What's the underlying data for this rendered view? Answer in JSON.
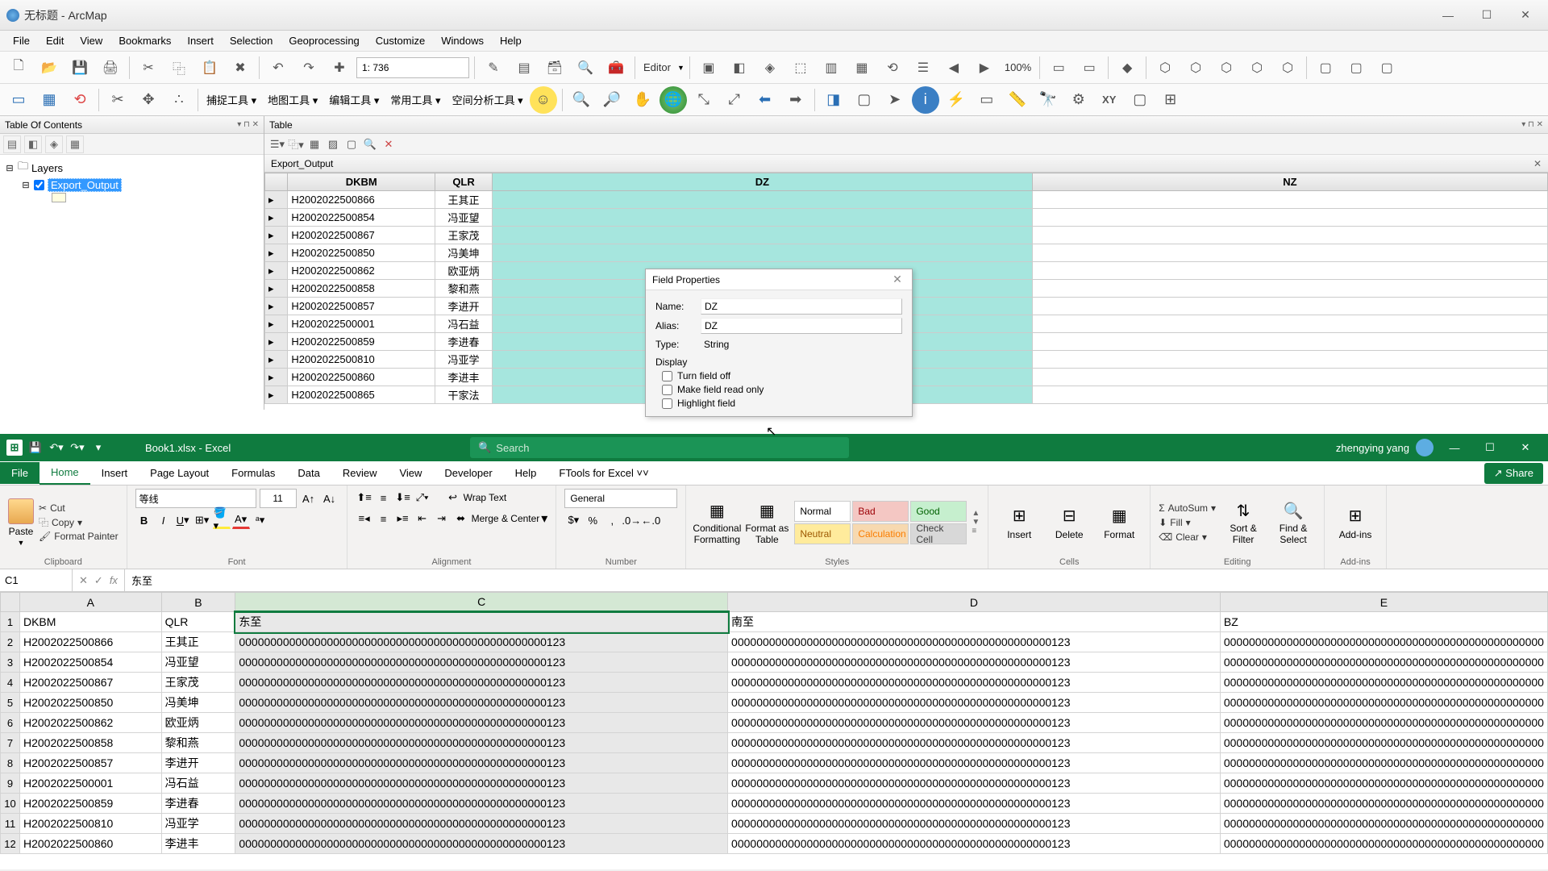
{
  "arcmap": {
    "title": "无标题 - ArcMap",
    "menu": [
      "File",
      "Edit",
      "View",
      "Bookmarks",
      "Insert",
      "Selection",
      "Geoprocessing",
      "Customize",
      "Windows",
      "Help"
    ],
    "scale": "1: 736",
    "editor_label": "Editor",
    "zoom_pct": "100%",
    "toolbox_labels": [
      "捕捉工具",
      "地图工具",
      "编辑工具",
      "常用工具",
      "空间分析工具"
    ],
    "toc": {
      "title": "Table Of Contents",
      "layers_label": "Layers",
      "layer_selected": "Export_Output"
    },
    "table_panel": {
      "title": "Table",
      "tab": "Export_Output",
      "cols": [
        "DKBM",
        "QLR",
        "DZ",
        "NZ"
      ],
      "rows": [
        {
          "dkbm": "H2002022500866",
          "qlr": "王其正"
        },
        {
          "dkbm": "H2002022500854",
          "qlr": "冯亚望"
        },
        {
          "dkbm": "H2002022500867",
          "qlr": "王家茂"
        },
        {
          "dkbm": "H2002022500850",
          "qlr": "冯美坤"
        },
        {
          "dkbm": "H2002022500862",
          "qlr": "欧亚炳"
        },
        {
          "dkbm": "H2002022500858",
          "qlr": "黎和燕"
        },
        {
          "dkbm": "H2002022500857",
          "qlr": "李进开"
        },
        {
          "dkbm": "H2002022500001",
          "qlr": "冯石益"
        },
        {
          "dkbm": "H2002022500859",
          "qlr": "李进春"
        },
        {
          "dkbm": "H2002022500810",
          "qlr": "冯亚学"
        },
        {
          "dkbm": "H2002022500860",
          "qlr": "李进丰"
        },
        {
          "dkbm": "H2002022500865",
          "qlr": "干家法"
        }
      ]
    },
    "field_dlg": {
      "title": "Field Properties",
      "name_lbl": "Name:",
      "name_val": "DZ",
      "alias_lbl": "Alias:",
      "alias_val": "DZ",
      "type_lbl": "Type:",
      "type_val": "String",
      "display_lbl": "Display",
      "chk1": "Turn field off",
      "chk2": "Make field read only",
      "chk3": "Highlight field"
    }
  },
  "excel": {
    "doc": "Book1.xlsx  -  Excel",
    "search_ph": "Search",
    "user": "zhengying yang",
    "tabs": [
      "File",
      "Home",
      "Insert",
      "Page Layout",
      "Formulas",
      "Data",
      "Review",
      "View",
      "Developer",
      "Help",
      "FTools for Excel ˅˅"
    ],
    "share": "Share",
    "clipboard": {
      "paste": "Paste",
      "cut": "Cut",
      "copy": "Copy",
      "fp": "Format Painter",
      "grp": "Clipboard"
    },
    "font": {
      "name": "等线",
      "size": "11",
      "grp": "Font"
    },
    "align": {
      "wrap": "Wrap Text",
      "merge": "Merge & Center",
      "grp": "Alignment"
    },
    "number": {
      "fmt": "General",
      "grp": "Number"
    },
    "styles": {
      "cf": "Conditional Formatting",
      "fat": "Format as Table",
      "normal": "Normal",
      "bad": "Bad",
      "good": "Good",
      "neutral": "Neutral",
      "calc": "Calculation",
      "check": "Check Cell",
      "grp": "Styles"
    },
    "cells": {
      "ins": "Insert",
      "del": "Delete",
      "fmt": "Format",
      "grp": "Cells"
    },
    "editing": {
      "sum": "AutoSum",
      "fill": "Fill",
      "clear": "Clear",
      "sort": "Sort & Filter",
      "find": "Find & Select",
      "grp": "Editing"
    },
    "addins": {
      "lbl": "Add-ins",
      "grp": "Add-ins"
    },
    "namebox": "C1",
    "formula": "东至",
    "cols": [
      "",
      "A",
      "B",
      "C",
      "D",
      "E"
    ],
    "hdr_row": {
      "A": "DKBM",
      "B": "QLR",
      "C": "东至",
      "D": "南至",
      "E": "BZ"
    },
    "long_c": "0000000000000000000000000000000000000000000000000123",
    "long_d": "000000000000000000000000000000000000000000000000000123",
    "long_e": "000000000000000000000000000000000000000000000000000",
    "rows": [
      {
        "n": "2",
        "A": "H2002022500866",
        "B": "王其正"
      },
      {
        "n": "3",
        "A": "H2002022500854",
        "B": "冯亚望"
      },
      {
        "n": "4",
        "A": "H2002022500867",
        "B": "王家茂"
      },
      {
        "n": "5",
        "A": "H2002022500850",
        "B": "冯美坤"
      },
      {
        "n": "6",
        "A": "H2002022500862",
        "B": "欧亚炳"
      },
      {
        "n": "7",
        "A": "H2002022500858",
        "B": "黎和燕"
      },
      {
        "n": "8",
        "A": "H2002022500857",
        "B": "李进开"
      },
      {
        "n": "9",
        "A": "H2002022500001",
        "B": "冯石益"
      },
      {
        "n": "10",
        "A": "H2002022500859",
        "B": "李进春"
      },
      {
        "n": "11",
        "A": "H2002022500810",
        "B": "冯亚学"
      },
      {
        "n": "12",
        "A": "H2002022500860",
        "B": "李进丰"
      }
    ]
  }
}
